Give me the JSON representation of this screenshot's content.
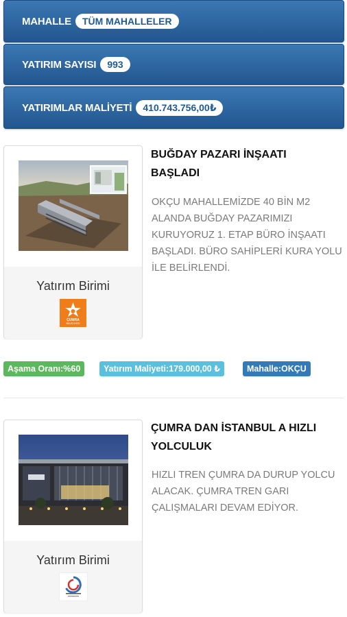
{
  "stats": {
    "mahalle": {
      "label": "MAHALLE",
      "value": "TÜM MAHALLELER"
    },
    "yatirim_sayisi": {
      "label": "YATIRIM SAYISI",
      "value": "993"
    },
    "yatirim_maliyeti": {
      "label": "YATIRIMLAR MALİYETİ",
      "value": "410.743.756,00₺"
    }
  },
  "news": [
    {
      "title": "BUĞDAY PAZARI İNŞAATI BAŞLADI",
      "body": "OKÇU MAHALLEMİZDE 40 BİN M2 ALANDA BUĞDAY PAZARIMIZI KURUYORUZ 1. ETAP BÜRO İNŞAATI BAŞLADI. BÜRO SAHİPLERİ KURA YOLU İLE BELİRLENDİ.",
      "unit_label": "Yatırım Birimi",
      "logo_text": "ÇUMRA BELEDİYESİ",
      "badges": {
        "progress": "Aşama Oranı:%60",
        "cost": "Yatırım Maliyeti:179.000,00 ₺",
        "district": "Mahalle:OKÇU"
      }
    },
    {
      "title": "ÇUMRA DAN İSTANBUL A HIZLI YOLCULUK",
      "body": "HIZLI TREN ÇUMRA DA DURUP YOLCU ALACAK. ÇUMRA TREN GARI ÇALIŞMALARI DEVAM EDİYOR.",
      "unit_label": "Yatırım Birimi"
    }
  ],
  "colors": {
    "header_blue": "#2a62a0",
    "badge_green": "#5cb85c",
    "badge_cyan": "#5bc0de",
    "badge_blue": "#337ab7",
    "logo_orange": "#ef7d1a"
  }
}
